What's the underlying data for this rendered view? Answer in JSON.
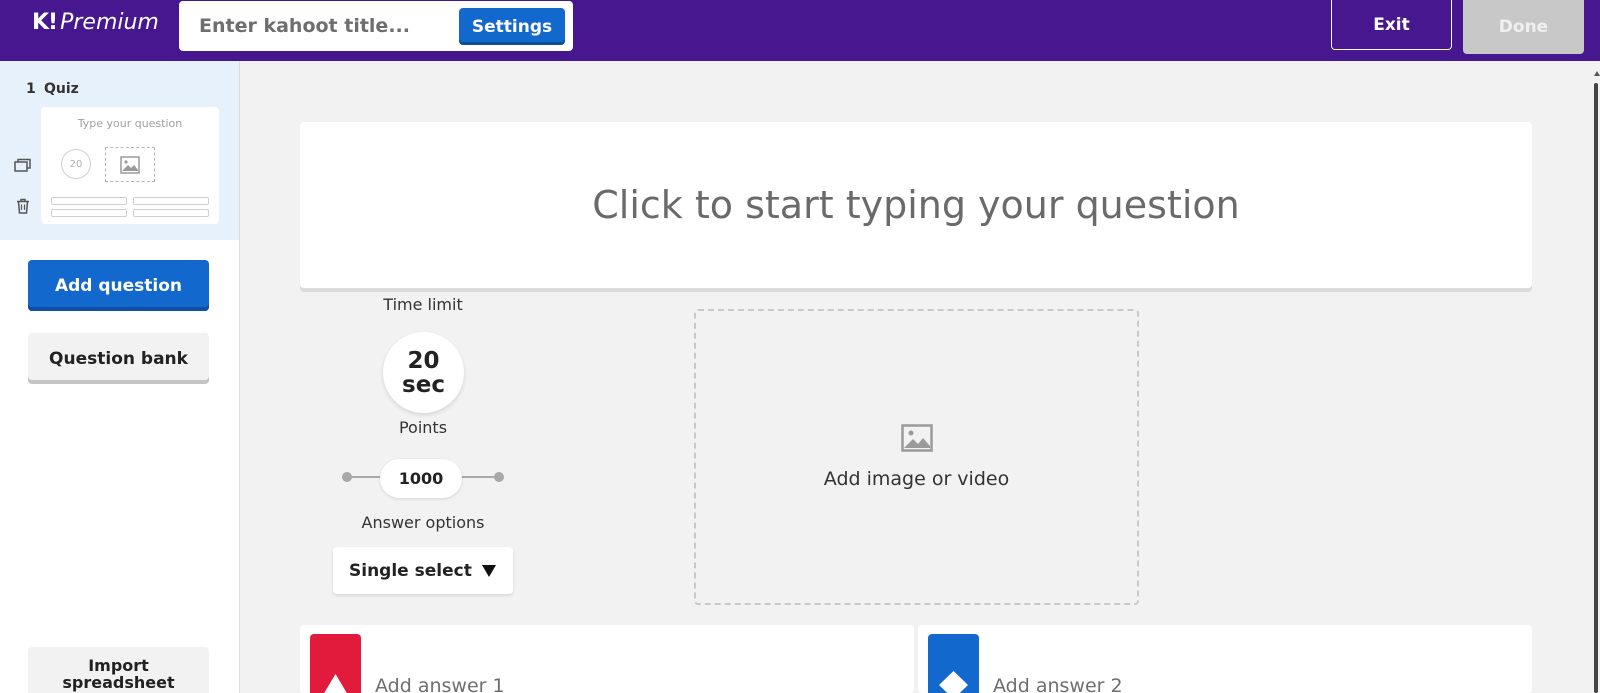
{
  "topbar": {
    "logo_mark": "K!",
    "logo_text": "Premium",
    "title_placeholder": "Enter kahoot title...",
    "settings_label": "Settings",
    "exit_label": "Exit",
    "done_label": "Done"
  },
  "sidebar": {
    "slides": [
      {
        "number": "1",
        "type": "Quiz",
        "thumb_question": "Type your question",
        "thumb_time": "20"
      }
    ],
    "add_question_label": "Add question",
    "question_bank_label": "Question bank",
    "import_label_line1": "Import",
    "import_label_line2": "spreadsheet"
  },
  "editor": {
    "question_placeholder": "Click to start typing your question",
    "time_limit_label": "Time limit",
    "time_value": "20",
    "time_unit": "sec",
    "points_label": "Points",
    "points_value": "1000",
    "answer_options_label": "Answer options",
    "answer_option_selected": "Single select",
    "media_label": "Add image or video",
    "answers": [
      {
        "label": "Add answer 1",
        "color": "#e21b3c",
        "shape": "triangle"
      },
      {
        "label": "Add answer 2",
        "color": "#1368ce",
        "shape": "diamond"
      }
    ]
  },
  "colors": {
    "topbar": "#46178f",
    "primary_button": "#1368ce",
    "selected_slide": "#e6f1fc",
    "done_disabled": "#c8c8c8"
  }
}
